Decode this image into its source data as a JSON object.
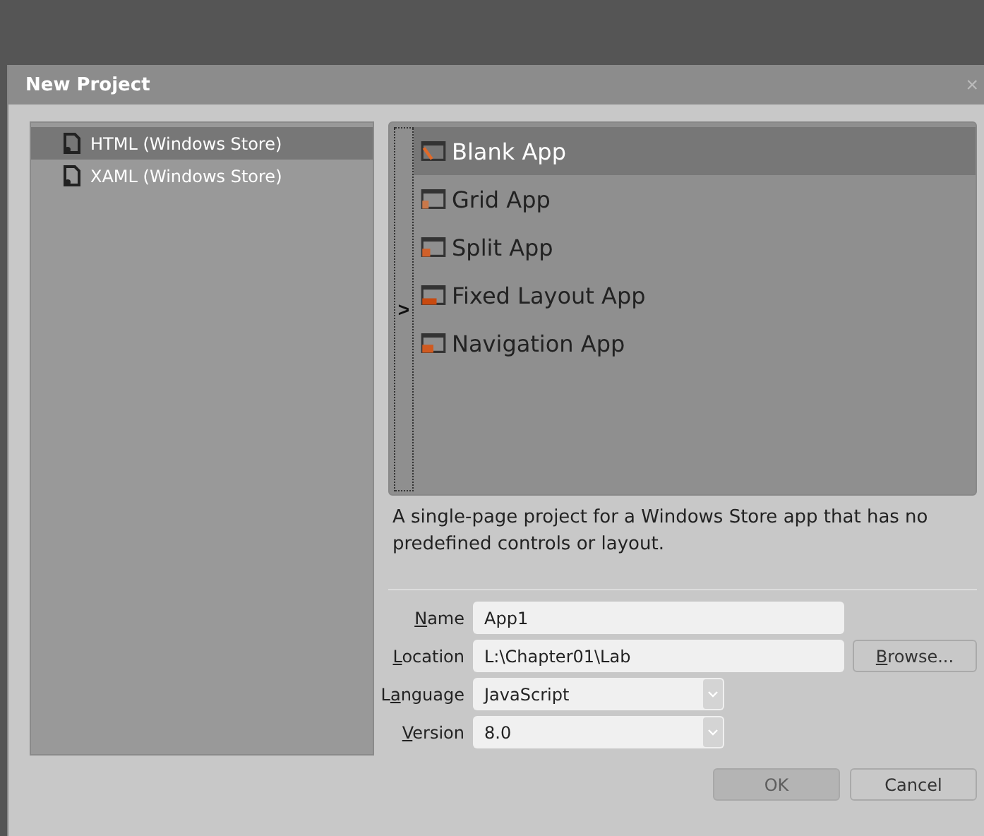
{
  "window": {
    "title": "New Project",
    "close": "×"
  },
  "categories": [
    {
      "label": "HTML (Windows Store)",
      "selected": true
    },
    {
      "label": "XAML (Windows Store)",
      "selected": false
    }
  ],
  "templates": [
    {
      "label": "Blank App",
      "kind": "blank",
      "selected": true
    },
    {
      "label": "Grid App",
      "kind": "grid",
      "selected": false
    },
    {
      "label": "Split App",
      "kind": "split",
      "selected": false
    },
    {
      "label": "Fixed Layout App",
      "kind": "fixed",
      "selected": false
    },
    {
      "label": "Navigation App",
      "kind": "navigation",
      "selected": false
    }
  ],
  "expander": {
    "glyph": ">"
  },
  "description": "A single-page project for a Windows Store app that has no predefined controls or layout.",
  "fields": [
    {
      "key": "N",
      "after": "ame",
      "value": "App1",
      "kind": "text"
    },
    {
      "key": "L",
      "after": "ocation",
      "value": "L:\\Chapter01\\Lab",
      "kind": "browse",
      "button": {
        "key": "B",
        "after": "rowse..."
      }
    },
    {
      "before": "L",
      "key": "a",
      "after": "nguage",
      "value": "JavaScript",
      "kind": "dropdown"
    },
    {
      "key": "V",
      "after": "ersion",
      "value": "8.0",
      "kind": "dropdown"
    }
  ],
  "buttons": [
    {
      "label": "OK",
      "disabled": true
    },
    {
      "label": "Cancel",
      "disabled": false
    }
  ]
}
